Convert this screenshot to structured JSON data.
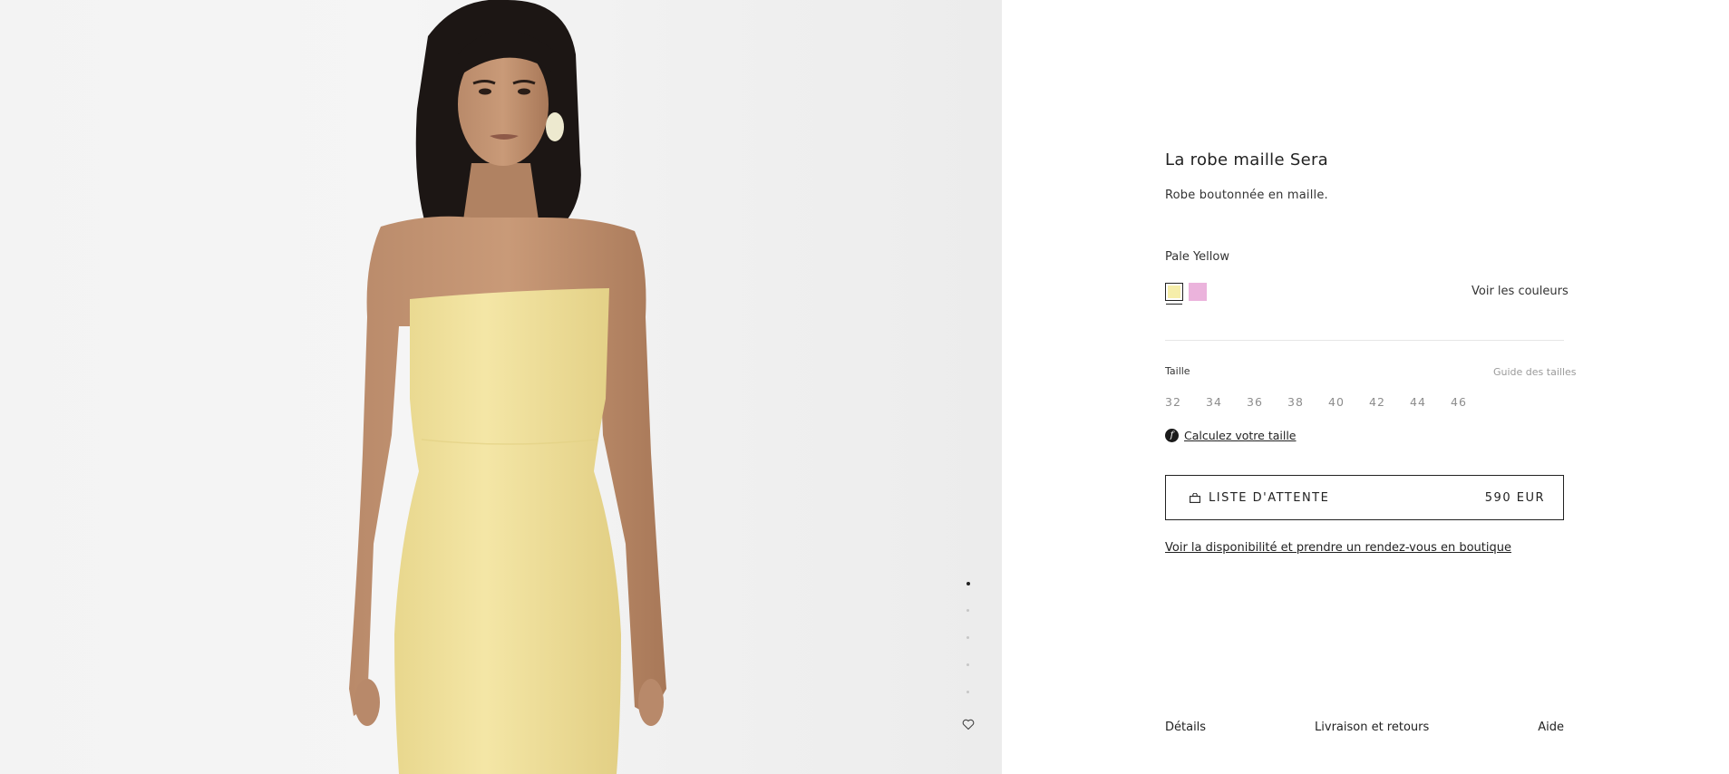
{
  "product": {
    "title": "La robe maille Sera",
    "subtitle": "Robe boutonnée en maille.",
    "color_name": "Pale Yellow",
    "see_colors_label": "Voir les couleurs",
    "swatches": [
      {
        "name": "pale-yellow",
        "color": "#f6eeaa",
        "selected": true
      },
      {
        "name": "pink",
        "color": "#ebb3dc",
        "selected": false
      }
    ]
  },
  "sizes": {
    "label": "Taille",
    "guide_label": "Guide des tailles",
    "options": [
      "32",
      "34",
      "36",
      "38",
      "40",
      "42",
      "44",
      "46"
    ],
    "calc_label": "Calculez votre taille"
  },
  "cta": {
    "label": "LISTE D'ATTENTE",
    "price": "590 EUR"
  },
  "store_link": "Voir la disponibilité et prendre un rendez-vous en boutique",
  "tabs": {
    "details": "Détails",
    "shipping": "Livraison et retours",
    "help": "Aide"
  },
  "gallery": {
    "slide_count": 5,
    "active_slide": 1
  },
  "colors": {
    "text": "#222222",
    "muted": "#8d8d8d",
    "dress": "#f2e39c"
  }
}
